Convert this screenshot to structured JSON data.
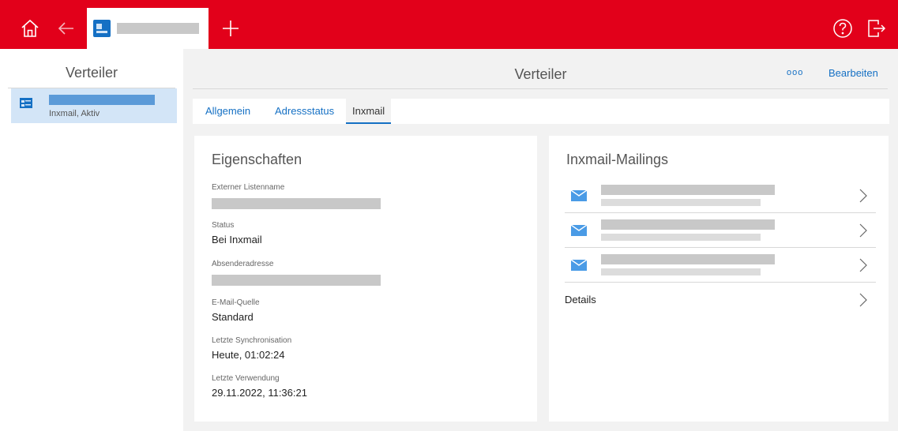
{
  "appbar": {
    "icons": [
      "home-icon",
      "back-arrow-icon",
      "distribution-list-icon",
      "plus-icon",
      "help-icon",
      "logout-icon"
    ],
    "accent": "#e2001a"
  },
  "sidebar": {
    "title": "Verteiler",
    "items": [
      {
        "subtitle": "Inxmail, Aktiv",
        "icon": "distribution-list-icon"
      }
    ]
  },
  "header": {
    "title": "Verteiler",
    "more_label": "ooo",
    "edit_label": "Bearbeiten"
  },
  "tabs": [
    {
      "label": "Allgemein"
    },
    {
      "label": "Adressstatus"
    },
    {
      "label": "Inxmail",
      "selected": true
    }
  ],
  "properties": {
    "title": "Eigenschaften",
    "items": [
      {
        "label": "Externer Listenname",
        "value": ""
      },
      {
        "label": "Status",
        "value": "Bei Inxmail"
      },
      {
        "label": "Absenderadresse",
        "value": ""
      },
      {
        "label": "E-Mail-Quelle",
        "value": "Standard"
      },
      {
        "label": "Letzte Synchronisation",
        "value": "Heute, 01:02:24"
      },
      {
        "label": "Letzte Verwendung",
        "value": "29.11.2022, 11:36:21"
      }
    ]
  },
  "mailings": {
    "title": "Inxmail-Mailings",
    "details_label": "Details",
    "icon": "mail-icon"
  },
  "colors": {
    "link": "#1570c4",
    "selection": "#d3e5f7",
    "background": "#f2f2f2"
  }
}
